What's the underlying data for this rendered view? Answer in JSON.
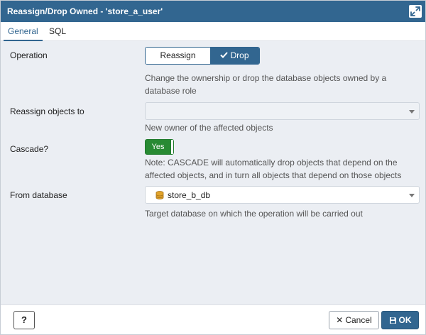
{
  "dialog": {
    "title": "Reassign/Drop Owned - 'store_a_user'"
  },
  "tabs": [
    {
      "label": "General",
      "active": true
    },
    {
      "label": "SQL",
      "active": false
    }
  ],
  "form": {
    "operation": {
      "label": "Operation",
      "options": [
        "Reassign",
        "Drop"
      ],
      "selected": "Drop",
      "help": "Change the ownership or drop the database objects owned by a database role"
    },
    "reassign_to": {
      "label": "Reassign objects to",
      "value": "",
      "help": "New owner of the affected objects"
    },
    "cascade": {
      "label": "Cascade?",
      "value": "Yes",
      "help": "Note: CASCADE will automatically drop objects that depend on the affected objects, and in turn all objects that depend on those objects"
    },
    "from_database": {
      "label": "From database",
      "value": "store_b_db",
      "help": "Target database on which the operation will be carried out"
    }
  },
  "footer": {
    "help_label": "?",
    "cancel_label": "Cancel",
    "ok_label": "OK"
  },
  "colors": {
    "primary": "#326690",
    "toggle_on": "#288a33",
    "content_bg": "#ebeef3"
  }
}
